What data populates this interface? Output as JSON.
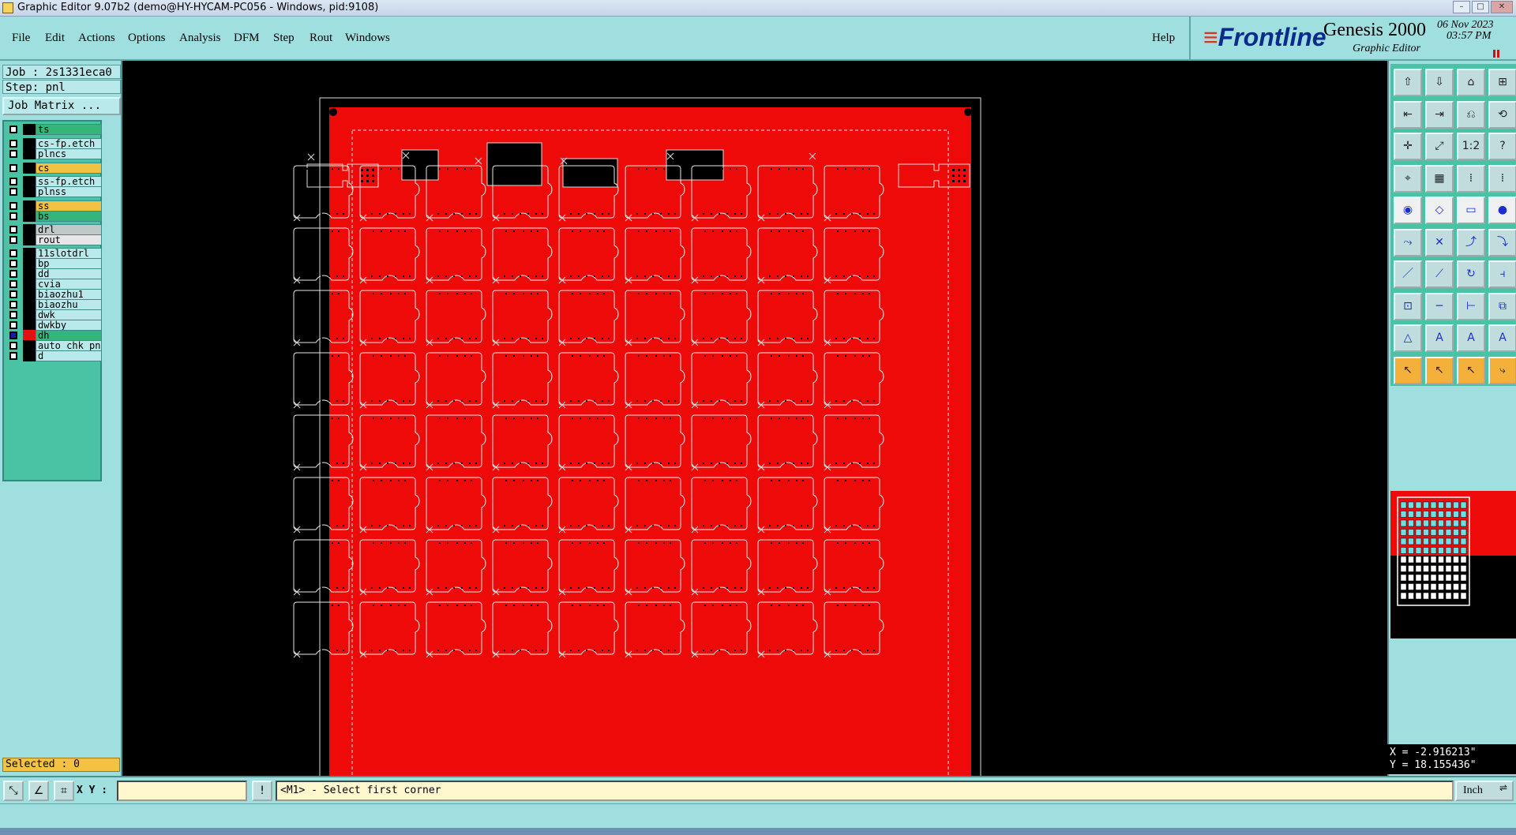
{
  "window": {
    "title": "Graphic Editor 9.07b2 (demo@HY-HYCAM-PC056 - Windows, pid:9108)"
  },
  "menu": {
    "items": [
      "File",
      "Edit",
      "Actions",
      "Options",
      "Analysis",
      "DFM",
      "Step",
      "Rout",
      "Windows"
    ],
    "help": "Help"
  },
  "brand": {
    "logo": "Frontline",
    "product": "Genesis 2000",
    "subtitle": "Graphic Editor",
    "date": "06 Nov 2023",
    "time": "03:57 PM"
  },
  "job": {
    "job_line": "Job : 2s1331eca0",
    "step_line": "Step: pnl",
    "matrix_button": "Job Matrix ..."
  },
  "layers": [
    {
      "name": "ts",
      "color": "#36b57a",
      "checked": false
    },
    {
      "name": "cs-fp.etch",
      "color": "#b9e9ea",
      "checked": false
    },
    {
      "name": "plncs",
      "color": "#b9e9ea",
      "checked": false
    },
    {
      "name": "cs",
      "color": "#f4c242",
      "checked": false
    },
    {
      "name": "ss-fp.etch",
      "color": "#b9e9ea",
      "checked": false
    },
    {
      "name": "plnss",
      "color": "#b9e9ea",
      "checked": false
    },
    {
      "name": "ss",
      "color": "#f4c242",
      "checked": false
    },
    {
      "name": "bs",
      "color": "#36b57a",
      "checked": false
    },
    {
      "name": "drl",
      "color": "#bfc9ca",
      "checked": false
    },
    {
      "name": "rout",
      "color": "#e6e6e6",
      "checked": false
    },
    {
      "name": "11slotdrl",
      "color": "#b9e9ea",
      "checked": false
    },
    {
      "name": "bp",
      "color": "#b9e9ea",
      "checked": false
    },
    {
      "name": "dd",
      "color": "#b9e9ea",
      "checked": false
    },
    {
      "name": "cvia",
      "color": "#b9e9ea",
      "checked": false
    },
    {
      "name": "biaozhu1",
      "color": "#b9e9ea",
      "checked": false
    },
    {
      "name": "biaozhu",
      "color": "#b9e9ea",
      "checked": false
    },
    {
      "name": "dwk",
      "color": "#b9e9ea",
      "checked": false
    },
    {
      "name": "dwkby",
      "color": "#b9e9ea",
      "checked": false
    },
    {
      "name": "dh",
      "color": "#36b57a",
      "checked": true,
      "display_color": "#e51010"
    },
    {
      "name": "auto_chk_pn",
      "color": "#b9e9ea",
      "checked": false
    },
    {
      "name": "d",
      "color": "#b9e9ea",
      "checked": false
    }
  ],
  "selected": "Selected : 0",
  "coords": {
    "x": "X = -2.916213\"",
    "y": "Y = 18.155436\""
  },
  "status": {
    "xy_label": "X Y :",
    "xy_value": "",
    "message": "<M1> - Select first corner",
    "units": "Inch"
  },
  "colors": {
    "panel": "#9fdfe0",
    "layer_red": "#ef0a0a",
    "accent_orange": "#f4c242"
  },
  "tools": [
    "add-feature",
    "save",
    "home",
    "layout",
    "prev",
    "next",
    "undo",
    "redo",
    "fit",
    "zoom",
    "scale-1-2",
    "help",
    "snap",
    "grid",
    "drill-check",
    "drill-check-2",
    "camera",
    "edit",
    "ruler",
    "pad",
    "connect",
    "cross",
    "arc-connect",
    "line-connect",
    "measure-line",
    "slope",
    "rotate",
    "mirror",
    "move",
    "line-cut",
    "resize",
    "copy",
    "triangle",
    "text-a",
    "text-a-2",
    "text-a-3",
    "pointer",
    "select",
    "select-circle",
    "select-route"
  ]
}
